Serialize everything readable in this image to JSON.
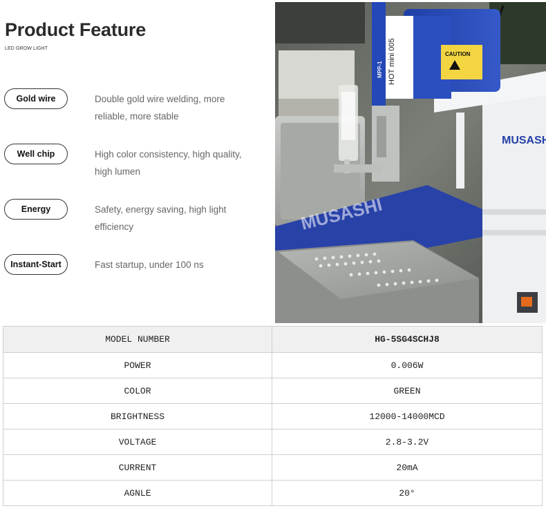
{
  "header": {
    "title": "Product Feature",
    "subtitle": "LED GROW LIGHT"
  },
  "features": [
    {
      "label": "Gold wire",
      "desc_line1": "Double gold wire welding, more",
      "desc_line2": "reliable, more stable"
    },
    {
      "label": "Well chip",
      "desc_line1": "High color consistency, high quality,",
      "desc_line2": "high lumen"
    },
    {
      "label": "Energy",
      "desc_line1": "Safety, energy saving, high light",
      "desc_line2": "efficiency"
    },
    {
      "label": "Instant-Start",
      "desc_line1": "Fast startup, under 100 ns",
      "desc_line2": ""
    }
  ],
  "photo": {
    "machine_brand": "MUSASHI",
    "machine_model_a": "MPP-1",
    "machine_model_b": "HOT mini 005",
    "caution_label": "CAUTION"
  },
  "spec_table": {
    "rows": [
      {
        "name": "MODEL NUMBER",
        "value": "HG-5SG4SCHJ8"
      },
      {
        "name": "POWER",
        "value": "0.006W"
      },
      {
        "name": "COLOR",
        "value": "GREEN"
      },
      {
        "name": "BRIGHTNESS",
        "value": "12000-14000MCD"
      },
      {
        "name": "VOLTAGE",
        "value": "2.8-3.2V"
      },
      {
        "name": "CURRENT",
        "value": "20mA"
      },
      {
        "name": "AGNLE",
        "value": "20°"
      }
    ]
  }
}
